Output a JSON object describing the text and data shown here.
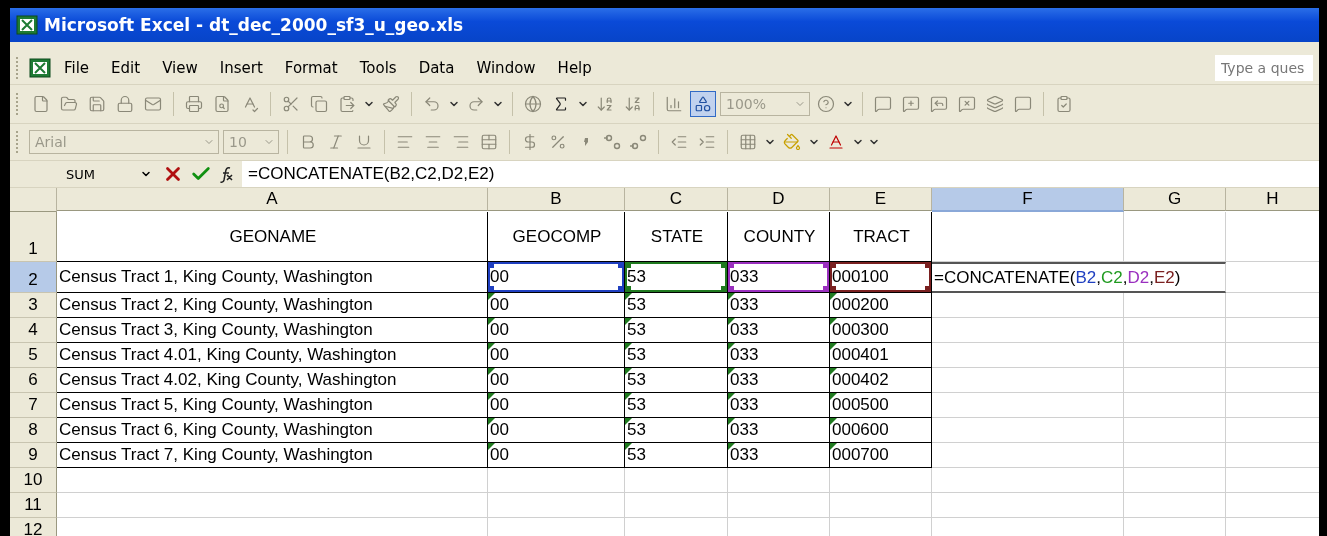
{
  "window": {
    "title": "Microsoft Excel - dt_dec_2000_sf3_u_geo.xls"
  },
  "menu": [
    "File",
    "Edit",
    "View",
    "Insert",
    "Format",
    "Tools",
    "Data",
    "Window",
    "Help"
  ],
  "help_search": {
    "placeholder": "Type a ques"
  },
  "toolbar": {
    "zoom": "100%"
  },
  "format_bar": {
    "font": "Arial",
    "size": "10"
  },
  "formula_bar": {
    "name_box": "SUM",
    "formula": "=CONCATENATE(B2,C2,D2,E2)"
  },
  "columns": [
    {
      "label": "A",
      "selected": false
    },
    {
      "label": "B",
      "selected": false
    },
    {
      "label": "C",
      "selected": false
    },
    {
      "label": "D",
      "selected": false
    },
    {
      "label": "E",
      "selected": false
    },
    {
      "label": "F",
      "selected": true
    },
    {
      "label": "G",
      "selected": false
    },
    {
      "label": "H",
      "selected": false
    }
  ],
  "rows": [
    {
      "number": "1",
      "selected": false,
      "cells": [
        {
          "text": "GEONAME",
          "kind": "header"
        },
        {
          "text": "GEOCOMP",
          "kind": "header"
        },
        {
          "text": "STATE",
          "kind": "header"
        },
        {
          "text": "COUNTY",
          "kind": "header"
        },
        {
          "text": "TRACT",
          "kind": "header"
        }
      ]
    },
    {
      "number": "2",
      "selected": true,
      "cells": [
        {
          "text": "Census Tract 1, King County, Washington",
          "kind": "data"
        },
        {
          "text": "00",
          "kind": "data",
          "color": "#1f3fc0"
        },
        {
          "text": "53",
          "kind": "data",
          "color": "#1f7a1f"
        },
        {
          "text": "033",
          "kind": "data",
          "color": "#9a2fbf"
        },
        {
          "text": "000100",
          "kind": "data",
          "color": "#7a2020"
        },
        {
          "kind": "formula",
          "editing": true,
          "parts": [
            {
              "text": "=CONCATENATE("
            },
            {
              "text": "B2",
              "color": "#1f3fc0"
            },
            {
              "text": ","
            },
            {
              "text": "C2",
              "color": "#1f9a1f"
            },
            {
              "text": ","
            },
            {
              "text": "D2",
              "color": "#9a2fbf"
            },
            {
              "text": ","
            },
            {
              "text": "E2",
              "color": "#7a2020"
            },
            {
              "text": ")"
            }
          ]
        }
      ]
    },
    {
      "number": "3",
      "selected": false,
      "cells": [
        {
          "text": "Census Tract 2, King County, Washington",
          "kind": "data"
        },
        {
          "text": "00",
          "kind": "data",
          "error_flag": true
        },
        {
          "text": "53",
          "kind": "data",
          "error_flag": true
        },
        {
          "text": "033",
          "kind": "data",
          "error_flag": true
        },
        {
          "text": "000200",
          "kind": "data",
          "error_flag": true
        }
      ]
    },
    {
      "number": "4",
      "selected": false,
      "cells": [
        {
          "text": "Census Tract 3, King County, Washington",
          "kind": "data"
        },
        {
          "text": "00",
          "kind": "data",
          "error_flag": true
        },
        {
          "text": "53",
          "kind": "data",
          "error_flag": true
        },
        {
          "text": "033",
          "kind": "data",
          "error_flag": true
        },
        {
          "text": "000300",
          "kind": "data",
          "error_flag": true
        }
      ]
    },
    {
      "number": "5",
      "selected": false,
      "cells": [
        {
          "text": "Census Tract 4.01, King County, Washington",
          "kind": "data"
        },
        {
          "text": "00",
          "kind": "data",
          "error_flag": true
        },
        {
          "text": "53",
          "kind": "data",
          "error_flag": true
        },
        {
          "text": "033",
          "kind": "data",
          "error_flag": true
        },
        {
          "text": "000401",
          "kind": "data",
          "error_flag": true
        }
      ]
    },
    {
      "number": "6",
      "selected": false,
      "cells": [
        {
          "text": "Census Tract 4.02, King County, Washington",
          "kind": "data"
        },
        {
          "text": "00",
          "kind": "data",
          "error_flag": true
        },
        {
          "text": "53",
          "kind": "data",
          "error_flag": true
        },
        {
          "text": "033",
          "kind": "data",
          "error_flag": true
        },
        {
          "text": "000402",
          "kind": "data",
          "error_flag": true
        }
      ]
    },
    {
      "number": "7",
      "selected": false,
      "cells": [
        {
          "text": "Census Tract 5, King County, Washington",
          "kind": "data"
        },
        {
          "text": "00",
          "kind": "data",
          "error_flag": true
        },
        {
          "text": "53",
          "kind": "data",
          "error_flag": true
        },
        {
          "text": "033",
          "kind": "data",
          "error_flag": true
        },
        {
          "text": "000500",
          "kind": "data",
          "error_flag": true
        }
      ]
    },
    {
      "number": "8",
      "selected": false,
      "cells": [
        {
          "text": "Census Tract 6, King County, Washington",
          "kind": "data"
        },
        {
          "text": "00",
          "kind": "data",
          "error_flag": true
        },
        {
          "text": "53",
          "kind": "data",
          "error_flag": true
        },
        {
          "text": "033",
          "kind": "data",
          "error_flag": true
        },
        {
          "text": "000600",
          "kind": "data",
          "error_flag": true
        }
      ]
    },
    {
      "number": "9",
      "selected": false,
      "cells": [
        {
          "text": "Census Tract 7, King County, Washington",
          "kind": "data"
        },
        {
          "text": "00",
          "kind": "data",
          "error_flag": true
        },
        {
          "text": "53",
          "kind": "data",
          "error_flag": true
        },
        {
          "text": "033",
          "kind": "data",
          "error_flag": true
        },
        {
          "text": "000700",
          "kind": "data",
          "error_flag": true
        }
      ]
    },
    {
      "number": "10",
      "selected": false
    },
    {
      "number": "11",
      "selected": false
    },
    {
      "number": "12",
      "selected": false
    }
  ]
}
